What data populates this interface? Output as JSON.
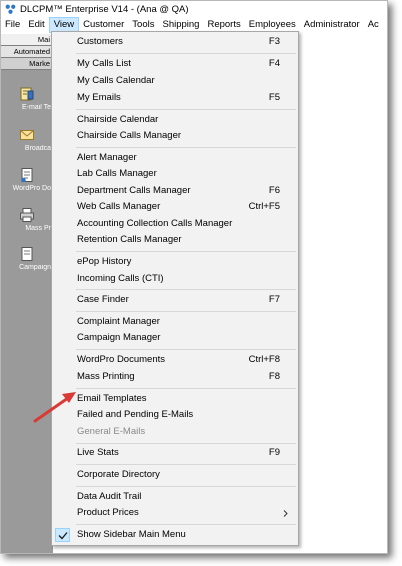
{
  "window": {
    "title": "DLCPM™ Enterprise V14 - (Ana @ QA)",
    "icon": "app-logo-icon"
  },
  "menubar": {
    "items": [
      "File",
      "Edit",
      "View",
      "Customer",
      "Tools",
      "Shipping",
      "Reports",
      "Employees",
      "Administrator",
      "Ac"
    ],
    "active": "View"
  },
  "sidebar": {
    "tabs": [
      "Mai",
      "Automated",
      "Marke"
    ],
    "items": [
      {
        "label": "E-mail Te",
        "icon": "email-templates-icon"
      },
      {
        "label": "Broadca",
        "icon": "broadcast-envelope-icon"
      },
      {
        "label": "WordPro Do",
        "icon": "wordpro-documents-icon"
      },
      {
        "label": "Mass Pr",
        "icon": "printer-icon"
      },
      {
        "label": "Campaign",
        "icon": "campaign-icon"
      }
    ]
  },
  "view_menu": {
    "items": [
      {
        "label": "Customers",
        "shortcut": "F3"
      },
      {
        "label": "My Calls List",
        "shortcut": "F4"
      },
      {
        "label": "My Calls Calendar",
        "shortcut": ""
      },
      {
        "label": "My Emails",
        "shortcut": "F5"
      },
      {
        "label": "Chairside Calendar",
        "shortcut": ""
      },
      {
        "label": "Chairside Calls Manager",
        "shortcut": ""
      },
      {
        "label": "Alert Manager",
        "shortcut": ""
      },
      {
        "label": "Lab Calls Manager",
        "shortcut": ""
      },
      {
        "label": "Department Calls Manager",
        "shortcut": "F6"
      },
      {
        "label": "Web Calls Manager",
        "shortcut": "Ctrl+F5"
      },
      {
        "label": "Accounting Collection Calls Manager",
        "shortcut": ""
      },
      {
        "label": "Retention Calls Manager",
        "shortcut": ""
      },
      {
        "label": "ePop History",
        "shortcut": ""
      },
      {
        "label": "Incoming Calls (CTI)",
        "shortcut": ""
      },
      {
        "label": "Case Finder",
        "shortcut": "F7"
      },
      {
        "label": "Complaint Manager",
        "shortcut": ""
      },
      {
        "label": "Campaign Manager",
        "shortcut": ""
      },
      {
        "label": "WordPro Documents",
        "shortcut": "Ctrl+F8"
      },
      {
        "label": "Mass Printing",
        "shortcut": "F8"
      },
      {
        "label": "Email Templates",
        "shortcut": ""
      },
      {
        "label": "Failed and Pending E-Mails",
        "shortcut": ""
      },
      {
        "label": "General E-Mails",
        "shortcut": "",
        "disabled": true
      },
      {
        "label": "Live Stats",
        "shortcut": "F9"
      },
      {
        "label": "Corporate Directory",
        "shortcut": ""
      },
      {
        "label": "Data Audit Trail",
        "shortcut": ""
      },
      {
        "label": "Product Prices",
        "shortcut": "",
        "submenu": true
      },
      {
        "label": "Show Sidebar Main Menu",
        "shortcut": "",
        "checked": true
      }
    ],
    "submenu_icon": "chevron-right-icon",
    "check_icon": "checkmark-icon"
  },
  "annotation": {
    "icon": "red-arrow-icon",
    "color": "#d93a36",
    "points_to": "Email Templates"
  }
}
